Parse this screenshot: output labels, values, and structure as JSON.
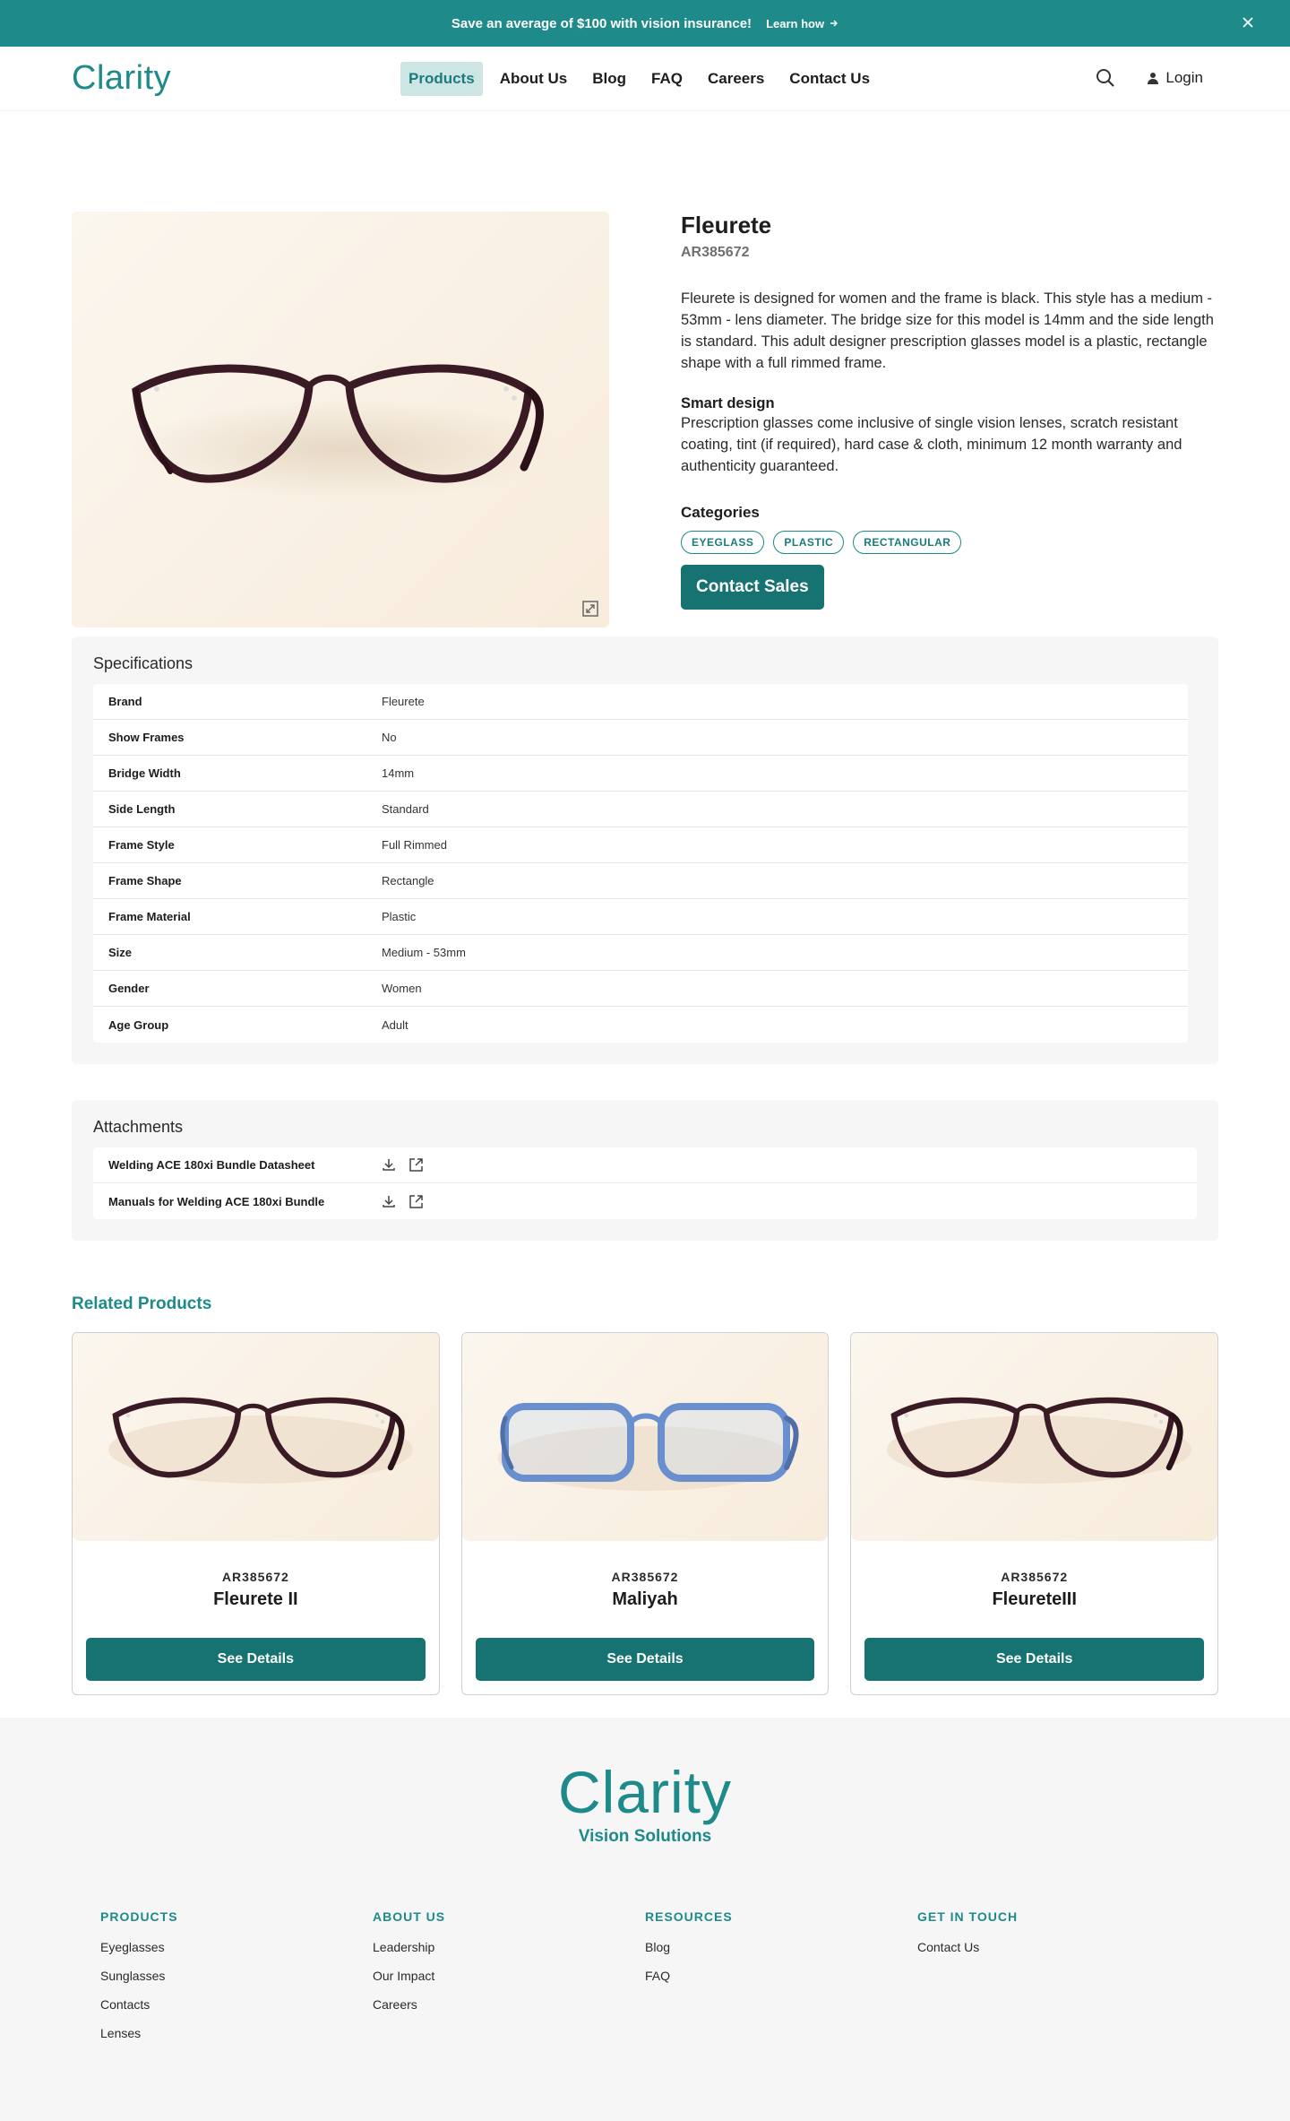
{
  "promo": {
    "text": "Save an average of $100 with vision insurance!",
    "link_label": "Learn how"
  },
  "header": {
    "logo": "Clarity",
    "nav": [
      "Products",
      "About Us",
      "Blog",
      "FAQ",
      "Careers",
      "Contact Us"
    ],
    "active_nav": "Products",
    "login_label": "Login"
  },
  "product": {
    "title": "Fleurete",
    "sku": "AR385672",
    "description": "Fleurete is designed for women and the frame is black. This style has a medium - 53mm - lens diameter. The bridge size for this model is 14mm and the side length is standard. This adult designer prescription glasses model is a plastic, rectangle shape with a full rimmed frame.",
    "smart_title": "Smart design",
    "smart_text": "Prescription glasses come inclusive of single vision lenses, scratch resistant coating, tint (if required), hard case & cloth, minimum 12 month warranty and authenticity guaranteed.",
    "categories_title": "Categories",
    "categories": [
      "EYEGLASS",
      "PLASTIC",
      "RECTANGULAR"
    ],
    "contact_button": "Contact Sales"
  },
  "specifications": {
    "title": "Specifications",
    "rows": [
      {
        "key": "Brand",
        "value": "Fleurete"
      },
      {
        "key": "Show Frames",
        "value": "No"
      },
      {
        "key": "Bridge Width",
        "value": "14mm"
      },
      {
        "key": "Side Length",
        "value": "Standard"
      },
      {
        "key": "Frame Style",
        "value": "Full Rimmed"
      },
      {
        "key": "Frame Shape",
        "value": "Rectangle"
      },
      {
        "key": "Frame Material",
        "value": "Plastic"
      },
      {
        "key": "Size",
        "value": "Medium - 53mm"
      },
      {
        "key": "Gender",
        "value": "Women"
      },
      {
        "key": "Age Group",
        "value": "Adult"
      }
    ]
  },
  "attachments": {
    "title": "Attachments",
    "items": [
      {
        "name": "Welding ACE 180xi Bundle Datasheet"
      },
      {
        "name": "Manuals for Welding ACE 180xi Bundle"
      }
    ]
  },
  "related": {
    "title": "Related Products",
    "items": [
      {
        "sku": "AR385672",
        "name": "Fleurete II",
        "button": "See Details",
        "style": "cat-eye-dark"
      },
      {
        "sku": "AR385672",
        "name": "Maliyah",
        "button": "See Details",
        "style": "rect-blue"
      },
      {
        "sku": "AR385672",
        "name": "FleureteIII",
        "button": "See Details",
        "style": "cat-eye-dark"
      }
    ]
  },
  "footer": {
    "logo": "Clarity",
    "tagline": "Vision Solutions",
    "columns": [
      {
        "heading": "PRODUCTS",
        "links": [
          "Eyeglasses",
          "Sunglasses",
          "Contacts",
          "Lenses"
        ]
      },
      {
        "heading": "ABOUT US",
        "links": [
          "Leadership",
          "Our Impact",
          "Careers"
        ]
      },
      {
        "heading": "RESOURCES",
        "links": [
          "Blog",
          "FAQ"
        ]
      },
      {
        "heading": "GET IN TOUCH",
        "links": [
          "Contact Us"
        ]
      }
    ]
  },
  "colors": {
    "brand": "#1e8a8a",
    "button": "#177272",
    "active_nav_bg": "#cde6e5"
  }
}
